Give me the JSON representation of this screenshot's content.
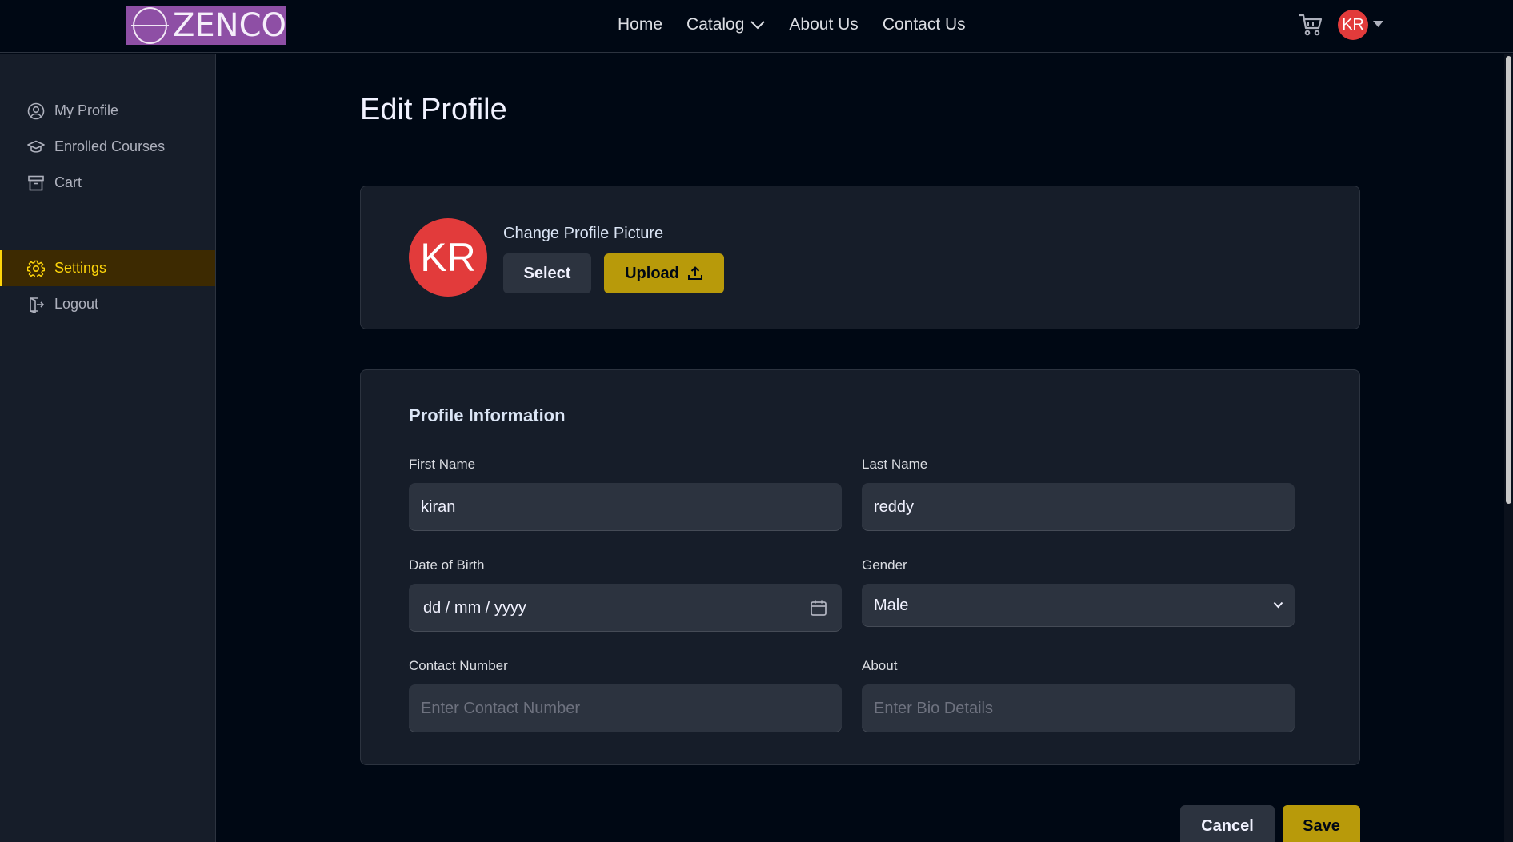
{
  "brand": {
    "logo_text": "ZENCO"
  },
  "nav": {
    "home": "Home",
    "catalog": "Catalog",
    "about": "About Us",
    "contact": "Contact Us",
    "avatar_initials": "KR"
  },
  "sidebar": {
    "items": [
      {
        "label": "My Profile",
        "icon": "user-circle-icon"
      },
      {
        "label": "Enrolled Courses",
        "icon": "graduation-cap-icon"
      },
      {
        "label": "Cart",
        "icon": "archive-box-icon"
      },
      {
        "label": "Settings",
        "icon": "gear-icon",
        "active": true
      },
      {
        "label": "Logout",
        "icon": "logout-icon"
      }
    ]
  },
  "page": {
    "title": "Edit Profile"
  },
  "picture_card": {
    "avatar_initials": "KR",
    "label": "Change Profile Picture",
    "select_label": "Select",
    "upload_label": "Upload"
  },
  "profile_info": {
    "title": "Profile Information",
    "first_name": {
      "label": "First Name",
      "value": "kiran"
    },
    "last_name": {
      "label": "Last Name",
      "value": "reddy"
    },
    "dob": {
      "label": "Date of Birth",
      "value": "dd / mm / yyyy"
    },
    "gender": {
      "label": "Gender",
      "value": "Male"
    },
    "contact": {
      "label": "Contact Number",
      "placeholder": "Enter Contact Number"
    },
    "about": {
      "label": "About",
      "placeholder": "Enter Bio Details"
    }
  },
  "actions": {
    "cancel": "Cancel",
    "save": "Save"
  },
  "colors": {
    "background": "#000814",
    "surface": "#161d29",
    "field": "#2c333f",
    "accent": "#ffd60a",
    "button_yellow": "#b89a0a",
    "avatar_red": "#e23b3b"
  }
}
